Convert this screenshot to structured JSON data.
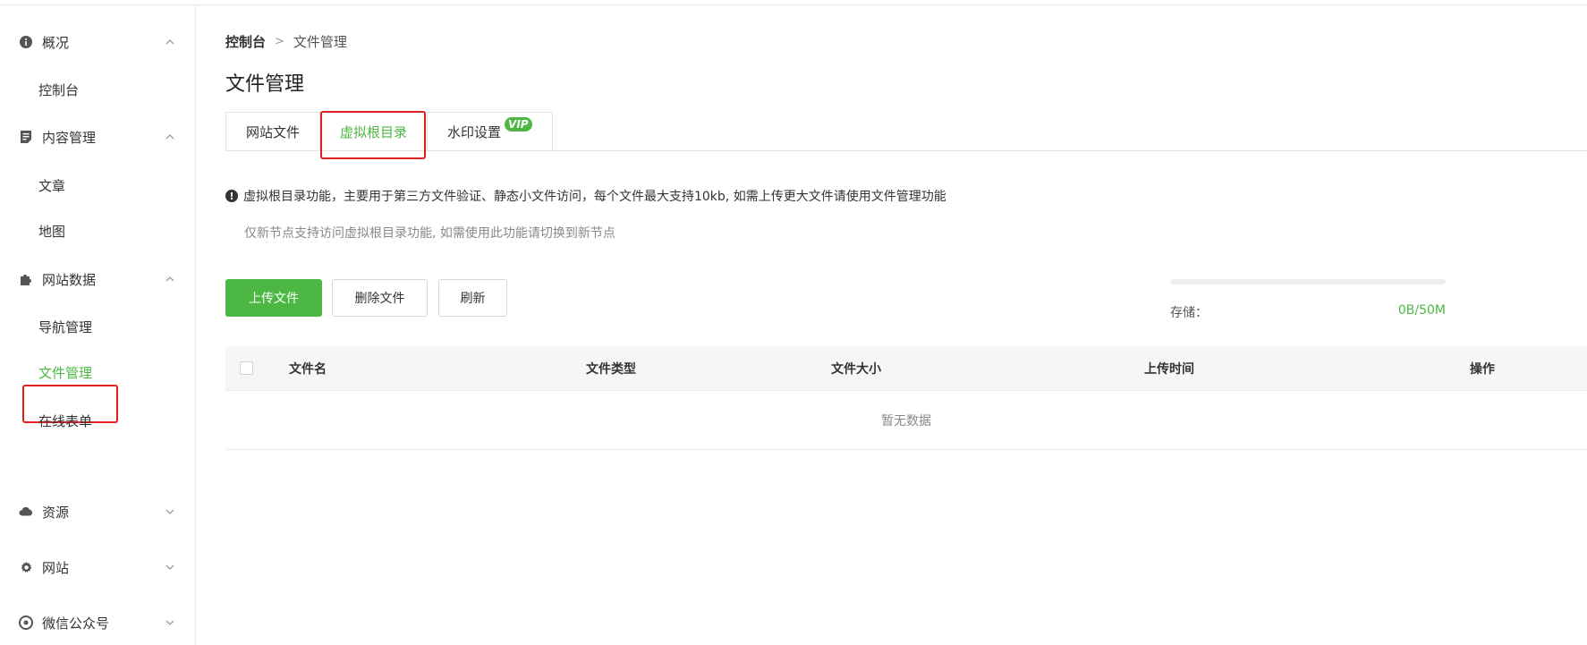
{
  "sidebar": {
    "groups": [
      {
        "label": "概况",
        "icon": "info-circle-icon",
        "expanded": true,
        "items": [
          {
            "label": "控制台"
          }
        ]
      },
      {
        "label": "内容管理",
        "icon": "document-icon",
        "expanded": true,
        "items": [
          {
            "label": "文章"
          },
          {
            "label": "地图"
          }
        ]
      },
      {
        "label": "网站数据",
        "icon": "puzzle-icon",
        "expanded": true,
        "items": [
          {
            "label": "导航管理"
          },
          {
            "label": "文件管理",
            "active": true
          },
          {
            "label": "在线表单"
          }
        ]
      },
      {
        "label": "资源",
        "icon": "cloud-icon",
        "expanded": false,
        "items": []
      },
      {
        "label": "网站",
        "icon": "gear-icon",
        "expanded": false,
        "items": []
      },
      {
        "label": "微信公众号",
        "icon": "wechat-icon",
        "expanded": false,
        "items": []
      }
    ]
  },
  "breadcrumb": {
    "root": "控制台",
    "separator": ">",
    "current": "文件管理"
  },
  "page": {
    "title": "文件管理"
  },
  "tabs": [
    {
      "label": "网站文件",
      "active": false
    },
    {
      "label": "虚拟根目录",
      "active": true
    },
    {
      "label": "水印设置",
      "active": false,
      "badge": "VIP"
    }
  ],
  "notice": {
    "text": "虚拟根目录功能，主要用于第三方文件验证、静态小文件访问，每个文件最大支持10kb, 如需上传更大文件请使用文件管理功能",
    "subtext": "仅新节点支持访问虚拟根目录功能, 如需使用此功能请切换到新节点"
  },
  "toolbar": {
    "upload_label": "上传文件",
    "delete_label": "删除文件",
    "refresh_label": "刷新"
  },
  "storage": {
    "label": "存储：",
    "value": "0B/50M",
    "used_fraction": 0
  },
  "table": {
    "columns": [
      "文件名",
      "文件类型",
      "文件大小",
      "上传时间",
      "操作"
    ],
    "empty_text": "暂无数据"
  },
  "colors": {
    "accent": "#4cb843",
    "highlight": "#e02020"
  }
}
